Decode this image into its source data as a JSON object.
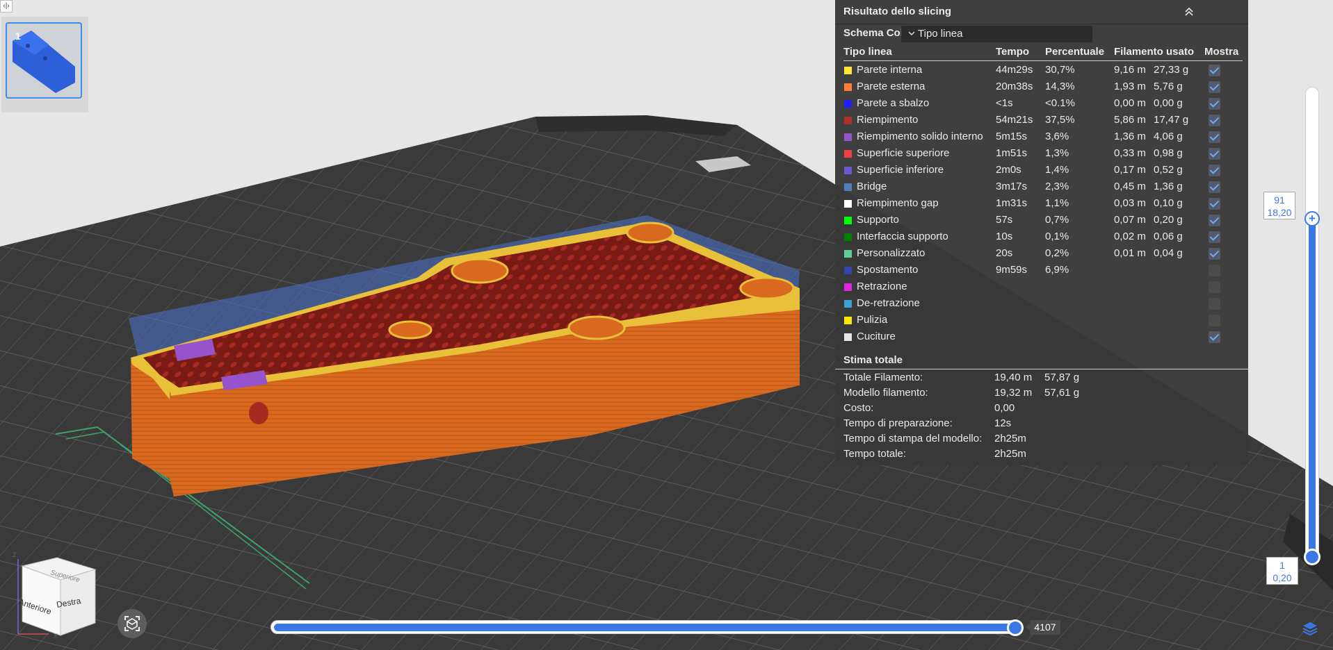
{
  "toolbar": {
    "toggle_icon": "‹|›"
  },
  "plate": {
    "number": "1"
  },
  "panel": {
    "title": "Risultato dello slicing",
    "color_scheme_label": "Schema Colore",
    "color_scheme_value": "Tipo linea",
    "headers": {
      "type": "Tipo linea",
      "time": "Tempo",
      "percent": "Percentuale",
      "filament": "Filamento usato",
      "show": "Mostra"
    },
    "rows": [
      {
        "name": "Parete interna",
        "color": "#ffe63c",
        "time": "44m29s",
        "pct": "30,7%",
        "len": "9,16 m",
        "weight": "27,33 g",
        "show": true
      },
      {
        "name": "Parete esterna",
        "color": "#ff7d38",
        "time": "20m38s",
        "pct": "14,3%",
        "len": "1,93 m",
        "weight": "5,76 g",
        "show": true
      },
      {
        "name": "Parete a sbalzo",
        "color": "#1f1fff",
        "time": "<1s",
        "pct": "<0.1%",
        "len": "0,00 m",
        "weight": "0,00 g",
        "show": true
      },
      {
        "name": "Riempimento",
        "color": "#b03029",
        "time": "54m21s",
        "pct": "37,5%",
        "len": "5,86 m",
        "weight": "17,47 g",
        "show": true
      },
      {
        "name": "Riempimento solido interno",
        "color": "#9654cc",
        "time": "5m15s",
        "pct": "3,6%",
        "len": "1,36 m",
        "weight": "4,06 g",
        "show": true
      },
      {
        "name": "Superficie superiore",
        "color": "#f04040",
        "time": "1m51s",
        "pct": "1,3%",
        "len": "0,33 m",
        "weight": "0,98 g",
        "show": true
      },
      {
        "name": "Superficie inferiore",
        "color": "#6a5acd",
        "time": "2m0s",
        "pct": "1,4%",
        "len": "0,17 m",
        "weight": "0,52 g",
        "show": true
      },
      {
        "name": "Bridge",
        "color": "#4d80ba",
        "time": "3m17s",
        "pct": "2,3%",
        "len": "0,45 m",
        "weight": "1,36 g",
        "show": true
      },
      {
        "name": "Riempimento gap",
        "color": "#ffffff",
        "time": "1m31s",
        "pct": "1,1%",
        "len": "0,03 m",
        "weight": "0,10 g",
        "show": true
      },
      {
        "name": "Supporto",
        "color": "#00ff00",
        "time": "57s",
        "pct": "0,7%",
        "len": "0,07 m",
        "weight": "0,20 g",
        "show": true
      },
      {
        "name": "Interfaccia supporto",
        "color": "#008000",
        "time": "10s",
        "pct": "0,1%",
        "len": "0,02 m",
        "weight": "0,06 g",
        "show": true
      },
      {
        "name": "Personalizzato",
        "color": "#5ed194",
        "time": "20s",
        "pct": "0,2%",
        "len": "0,01 m",
        "weight": "0,04 g",
        "show": true
      },
      {
        "name": "Spostamento",
        "color": "#3344aa",
        "time": "9m59s",
        "pct": "6,9%",
        "len": "",
        "weight": "",
        "show": false
      },
      {
        "name": "Retrazione",
        "color": "#e024e0",
        "time": "",
        "pct": "",
        "len": "",
        "weight": "",
        "show": false
      },
      {
        "name": "De-retrazione",
        "color": "#3ca0d0",
        "time": "",
        "pct": "",
        "len": "",
        "weight": "",
        "show": false
      },
      {
        "name": "Pulizia",
        "color": "#ffe600",
        "time": "",
        "pct": "",
        "len": "",
        "weight": "",
        "show": false
      },
      {
        "name": "Cuciture",
        "color": "#e6e6e6",
        "time": "",
        "pct": "",
        "len": "",
        "weight": "",
        "show": true
      }
    ],
    "totals_title": "Stima totale",
    "totals": [
      {
        "label": "Totale Filamento:",
        "v1": "19,40 m",
        "v2": "57,87 g"
      },
      {
        "label": "Modello filamento:",
        "v1": "19,32 m",
        "v2": "57,61 g"
      },
      {
        "label": "Costo:",
        "v1": "0,00",
        "v2": ""
      },
      {
        "label": "Tempo di preparazione:",
        "v1": "12s",
        "v2": ""
      },
      {
        "label": "Tempo di stampa del modello:",
        "v1": "2h25m",
        "v2": ""
      },
      {
        "label": "Tempo totale:",
        "v1": "2h25m",
        "v2": ""
      }
    ]
  },
  "vertical_slider": {
    "top_layer": "91",
    "top_height": "18,20",
    "bottom_layer": "1",
    "bottom_height": "0,20"
  },
  "horizontal_slider": {
    "value": "4107"
  },
  "view_cube": {
    "top": "Superiore",
    "front": "Anteriore",
    "right": "Destra",
    "axis_z": "Z",
    "axis_x": "X"
  },
  "icons": [
    "collapse-icon",
    "chevron-down-icon",
    "layers-icon",
    "fit-view-icon"
  ]
}
